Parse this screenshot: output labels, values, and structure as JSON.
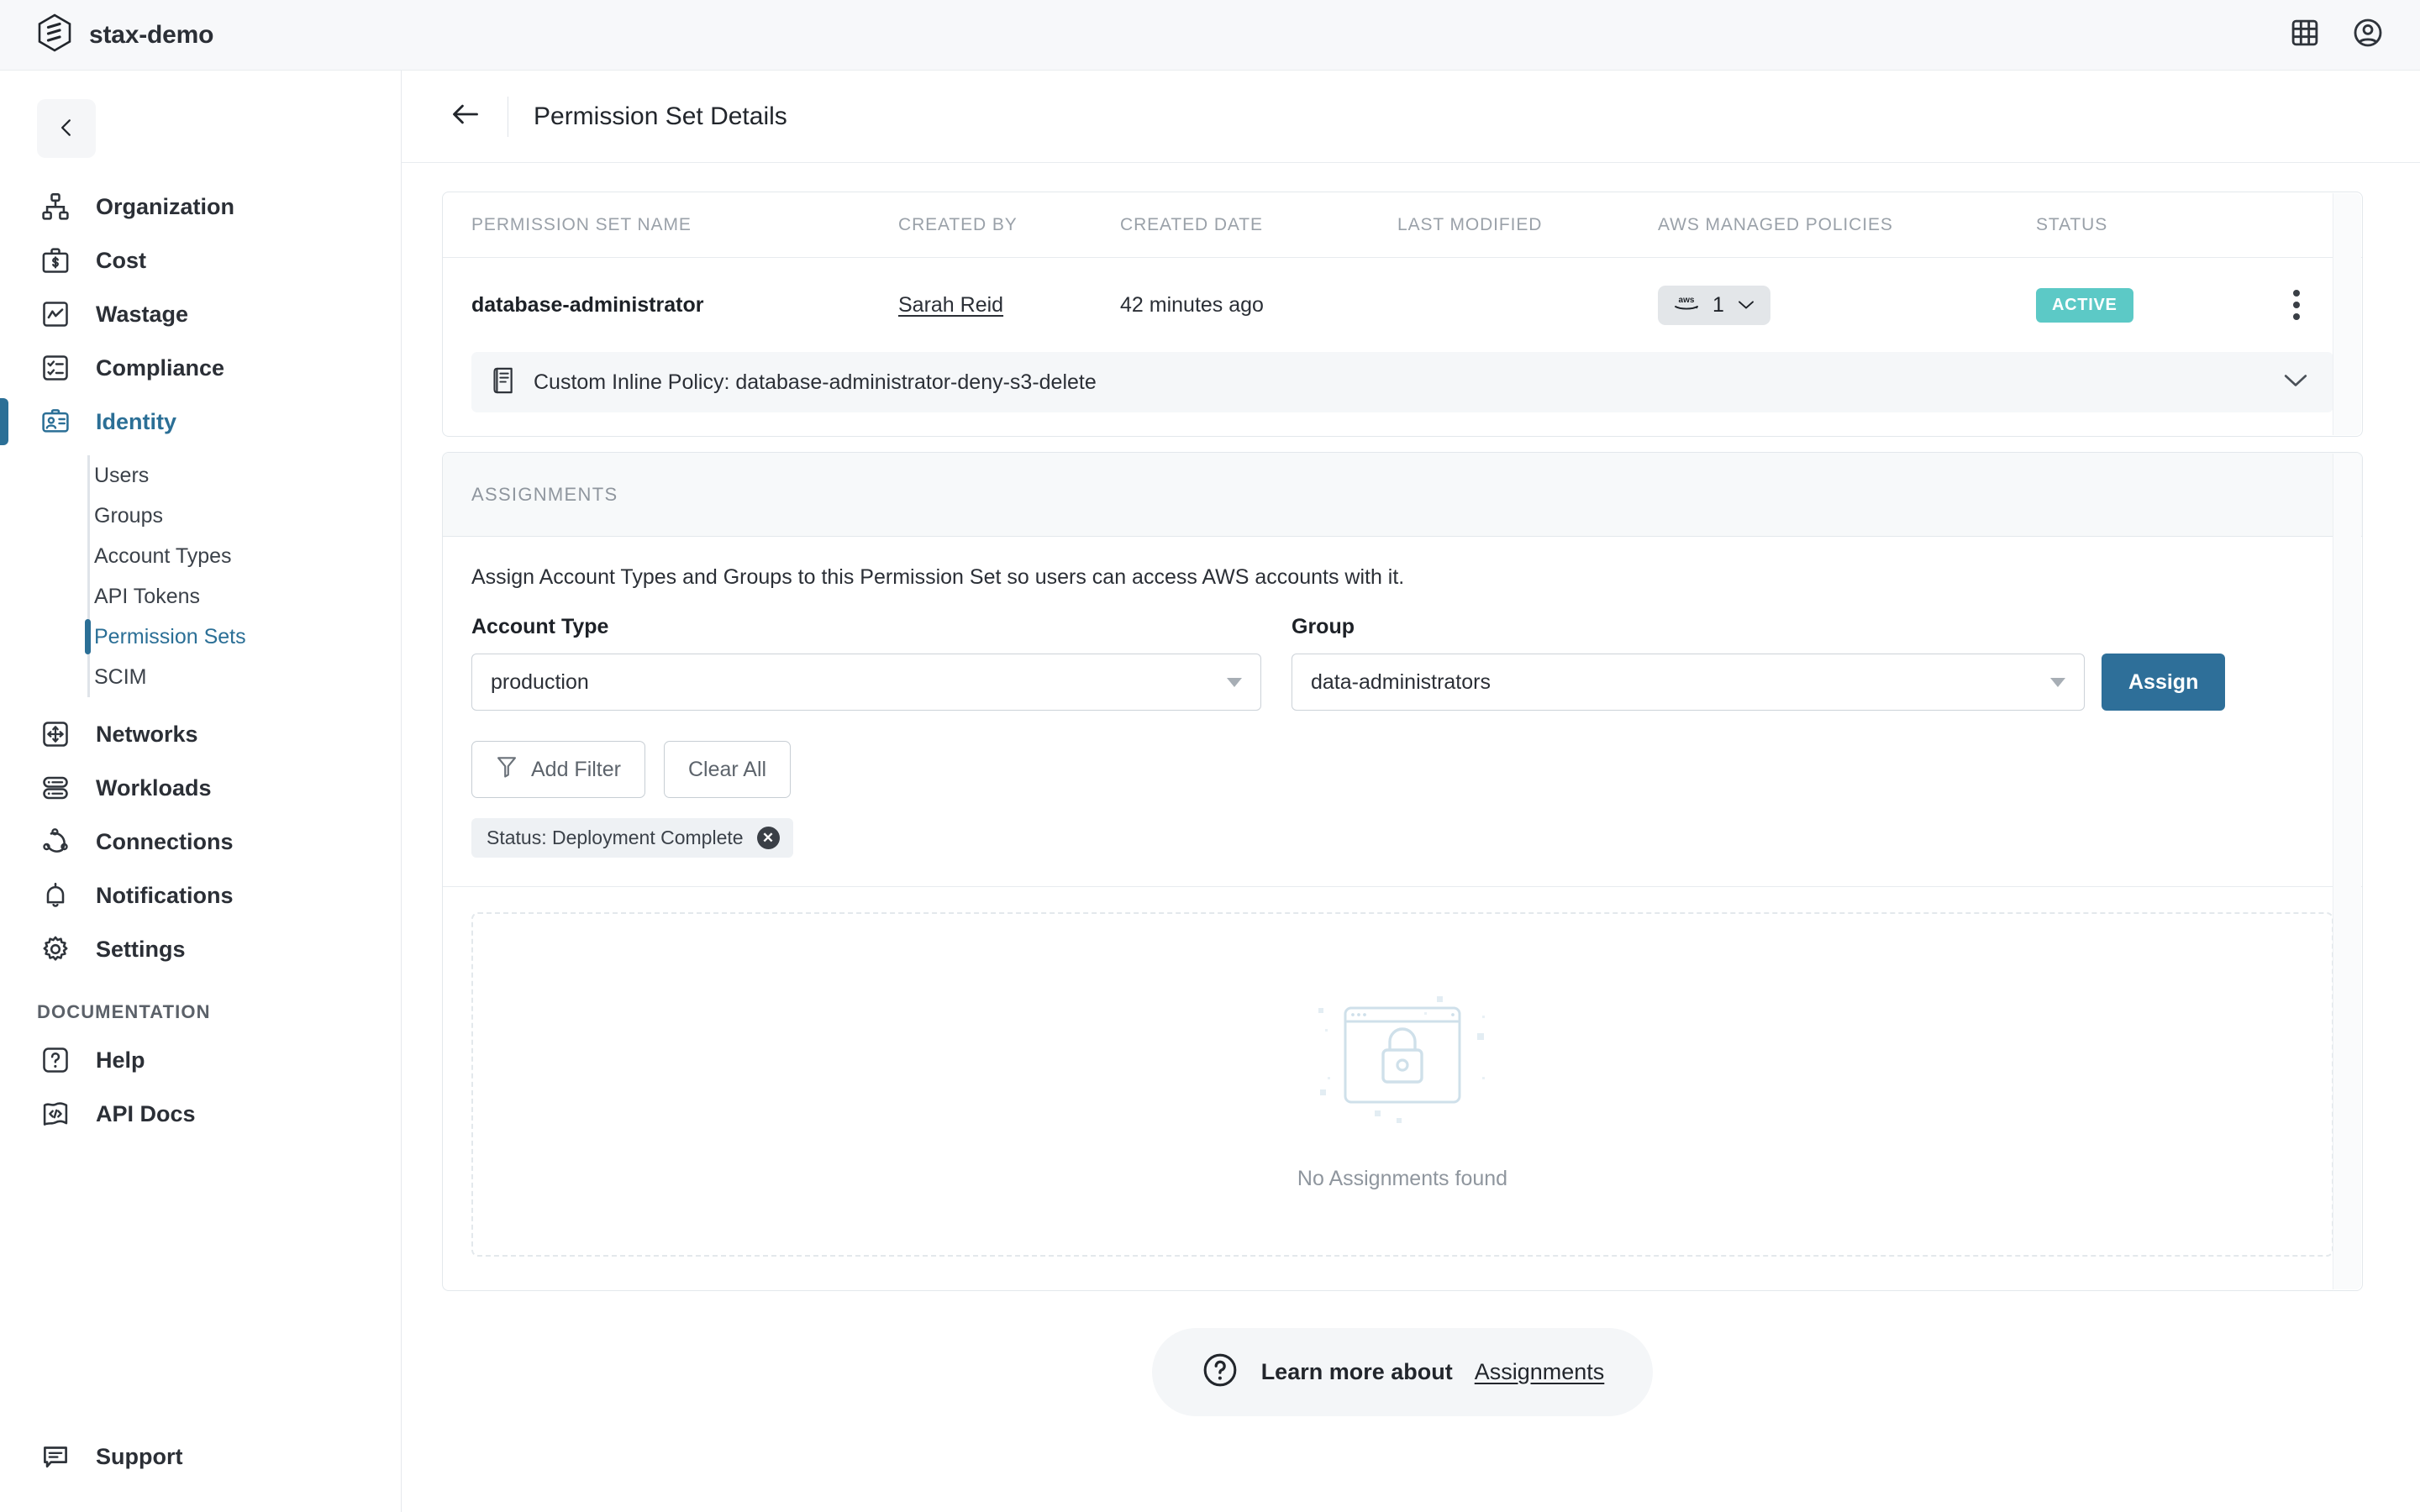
{
  "topbar": {
    "brand_name": "stax-demo",
    "logo_icon": "stax-hexagon-logo",
    "apps_icon": "grid-apps-icon",
    "account_icon": "user-account-icon"
  },
  "sidebar": {
    "collapse_icon": "chevron-left-icon",
    "items": [
      {
        "label": "Organization",
        "icon": "org-chart-icon",
        "active": false
      },
      {
        "label": "Cost",
        "icon": "briefcase-dollar-icon",
        "active": false
      },
      {
        "label": "Wastage",
        "icon": "chart-line-icon",
        "active": false
      },
      {
        "label": "Compliance",
        "icon": "checklist-icon",
        "active": false
      },
      {
        "label": "Identity",
        "icon": "id-card-icon",
        "active": true
      }
    ],
    "subitems": [
      {
        "label": "Users",
        "active": false
      },
      {
        "label": "Groups",
        "active": false
      },
      {
        "label": "Account Types",
        "active": false
      },
      {
        "label": "API Tokens",
        "active": false
      },
      {
        "label": "Permission Sets",
        "active": true
      },
      {
        "label": "SCIM",
        "active": false
      }
    ],
    "items_lower": [
      {
        "label": "Networks",
        "icon": "network-arrows-icon"
      },
      {
        "label": "Workloads",
        "icon": "server-stack-icon"
      },
      {
        "label": "Connections",
        "icon": "connections-nodes-icon"
      },
      {
        "label": "Notifications",
        "icon": "bell-icon"
      },
      {
        "label": "Settings",
        "icon": "gear-icon"
      }
    ],
    "section_title": "DOCUMENTATION",
    "docs_items": [
      {
        "label": "Help",
        "icon": "question-square-icon"
      },
      {
        "label": "API Docs",
        "icon": "code-doc-icon"
      }
    ],
    "support": {
      "label": "Support",
      "icon": "speech-bubble-icon"
    }
  },
  "page": {
    "back_icon": "arrow-left-icon",
    "title": "Permission Set Details"
  },
  "permission_table": {
    "columns": [
      "PERMISSION SET NAME",
      "CREATED BY",
      "CREATED DATE",
      "LAST MODIFIED",
      "AWS MANAGED POLICIES",
      "STATUS"
    ],
    "row": {
      "name": "database-administrator",
      "created_by": "Sarah Reid",
      "created_date": "42 minutes ago",
      "last_modified": "",
      "aws_policies_count": "1",
      "aws_icon": "aws-logo-icon",
      "policies_caret_icon": "chevron-down-icon",
      "status": "ACTIVE",
      "status_color": "#5cc9c6",
      "kebab_icon": "kebab-menu-icon"
    },
    "inline_policy": {
      "icon": "policy-document-icon",
      "label": "Custom Inline Policy: database-administrator-deny-s3-delete",
      "expand_icon": "chevron-down-icon"
    }
  },
  "assignments": {
    "section_title": "ASSIGNMENTS",
    "description": "Assign Account Types and Groups to this Permission Set so users can access AWS accounts with it.",
    "account_type": {
      "label": "Account Type",
      "value": "production",
      "caret_icon": "caret-down-icon"
    },
    "group": {
      "label": "Group",
      "value": "data-administrators",
      "caret_icon": "caret-down-icon"
    },
    "assign_button": "Assign",
    "assign_button_color": "#2e6f99",
    "add_filter_button": "Add Filter",
    "add_filter_icon": "funnel-filter-icon",
    "clear_all_button": "Clear All",
    "filter_chips": [
      {
        "label": "Status: Deployment Complete",
        "remove_icon": "close-circle-icon"
      }
    ],
    "empty_state": {
      "illustration": "locked-browser-window-icon",
      "text": "No Assignments found"
    }
  },
  "learn_more": {
    "icon": "question-circle-icon",
    "label": "Learn more about",
    "link": "Assignments"
  }
}
